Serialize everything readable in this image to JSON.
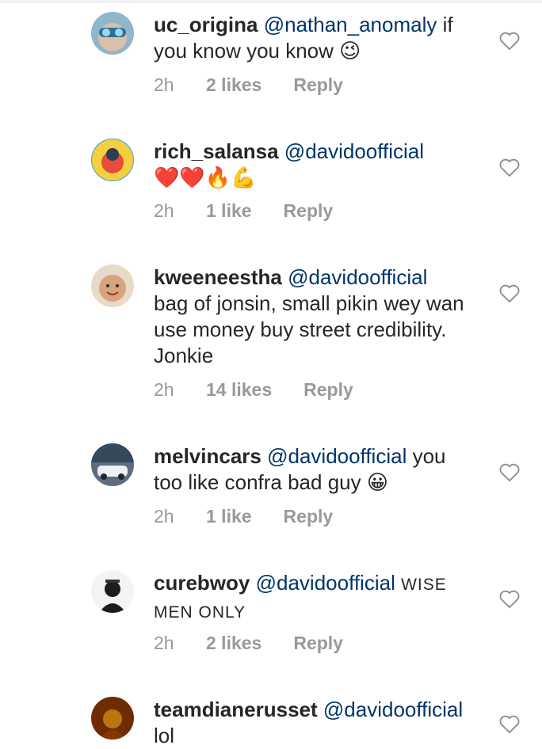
{
  "comments": [
    {
      "username": "uc_origina",
      "mention": "@nathan_anomaly",
      "text": "if you know you know 😉",
      "time": "2h",
      "likes": "2 likes",
      "reply": "Reply"
    },
    {
      "username": "rich_salansa",
      "mention": "@davidoofficial",
      "text": "❤️❤️🔥💪",
      "time": "2h",
      "likes": "1 like",
      "reply": "Reply"
    },
    {
      "username": "kweeneestha",
      "mention": "@davidoofficial",
      "text": "bag of jonsin, small pikin wey wan use money buy street credibility. Jonkie",
      "time": "2h",
      "likes": "14 likes",
      "reply": "Reply"
    },
    {
      "username": "melvincars",
      "mention": "@davidoofficial",
      "text": "you too like confra bad guy 😀",
      "time": "2h",
      "likes": "1 like",
      "reply": "Reply"
    },
    {
      "username": "curebwoy",
      "mention": "@davidoofficial",
      "text": "Wise men only",
      "time": "2h",
      "likes": "2 likes",
      "reply": "Reply"
    },
    {
      "username": "teamdianerusset",
      "mention": "@davidoofficial",
      "text": "lol"
    }
  ],
  "icons": {
    "like": "heart-outline-icon"
  },
  "colors": {
    "mention": "#003569",
    "meta": "#999999",
    "text": "#262626"
  }
}
